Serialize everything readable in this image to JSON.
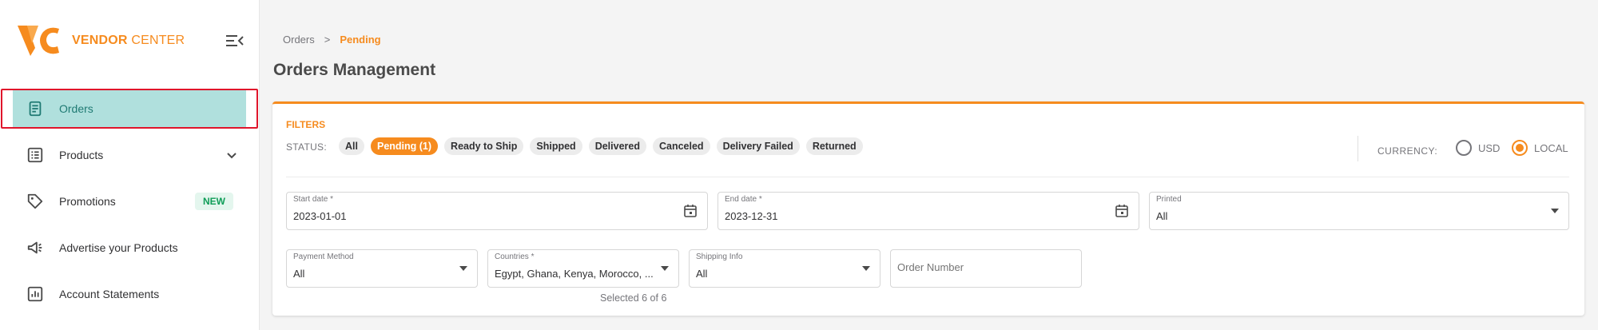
{
  "brand": {
    "name_bold": "VENDOR",
    "name_thin": "CENTER",
    "accent": "#f68b1e"
  },
  "sidebar": {
    "items": [
      {
        "label": "Orders",
        "icon": "orders-icon",
        "active": true
      },
      {
        "label": "Products",
        "icon": "products-icon",
        "expandable": true
      },
      {
        "label": "Promotions",
        "icon": "tag-icon",
        "badge": "NEW"
      },
      {
        "label": "Advertise your Products",
        "icon": "megaphone-icon"
      },
      {
        "label": "Account Statements",
        "icon": "statement-icon"
      }
    ]
  },
  "breadcrumb": {
    "parent": "Orders",
    "separator": ">",
    "current": "Pending"
  },
  "page": {
    "title": "Orders Management"
  },
  "filters": {
    "title": "FILTERS",
    "status_label": "STATUS:",
    "statuses": [
      "All",
      "Pending (1)",
      "Ready to Ship",
      "Shipped",
      "Delivered",
      "Canceled",
      "Delivery Failed",
      "Returned"
    ],
    "active_status": "Pending (1)",
    "currency": {
      "label": "CURRENCY:",
      "options": [
        "USD",
        "LOCAL"
      ],
      "selected": "LOCAL"
    },
    "start_date": {
      "label": "Start date *",
      "value": "2023-01-01"
    },
    "end_date": {
      "label": "End date *",
      "value": "2023-12-31"
    },
    "printed": {
      "label": "Printed",
      "value": "All"
    },
    "payment_method": {
      "label": "Payment Method",
      "value": "All"
    },
    "countries": {
      "label": "Countries *",
      "value": "Egypt, Ghana, Kenya, Morocco, ...",
      "note": "Selected 6 of 6"
    },
    "shipping_info": {
      "label": "Shipping Info",
      "value": "All"
    },
    "order_number": {
      "placeholder": "Order Number",
      "value": ""
    }
  }
}
